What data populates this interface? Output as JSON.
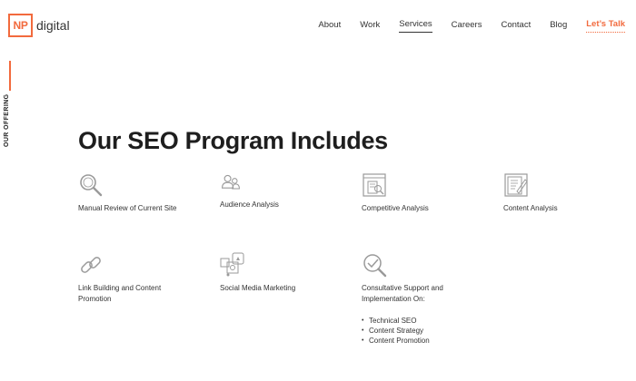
{
  "logo": {
    "mark": "NP",
    "text": "digital"
  },
  "nav": [
    {
      "label": "About"
    },
    {
      "label": "Work"
    },
    {
      "label": "Services"
    },
    {
      "label": "Careers"
    },
    {
      "label": "Contact"
    },
    {
      "label": "Blog"
    },
    {
      "label": "Let’s Talk"
    }
  ],
  "active_nav": "Services",
  "side_label": "OUR OFFERING",
  "title": "Our SEO Program Includes",
  "items": [
    {
      "icon": "magnifier-icon",
      "label": "Manual Review of Current Site"
    },
    {
      "icon": "audience-icon",
      "label": "Audience Analysis"
    },
    {
      "icon": "competitive-analysis-icon",
      "label": "Competitive Analysis"
    },
    {
      "icon": "content-analysis-icon",
      "label": "Content Analysis"
    },
    {
      "icon": "link-icon",
      "label": "Link Building and Content Promotion"
    },
    {
      "icon": "social-media-icon",
      "label": "Social Media Marketing"
    },
    {
      "icon": "support-search-icon",
      "label": "Consultative Support and Implementation On:",
      "bullets": [
        "Technical SEO",
        "Content Strategy",
        "Content Promotion"
      ]
    }
  ],
  "colors": {
    "accent": "#f26a3d",
    "text": "#2b2b2b",
    "icon": "#9a9a9a"
  }
}
